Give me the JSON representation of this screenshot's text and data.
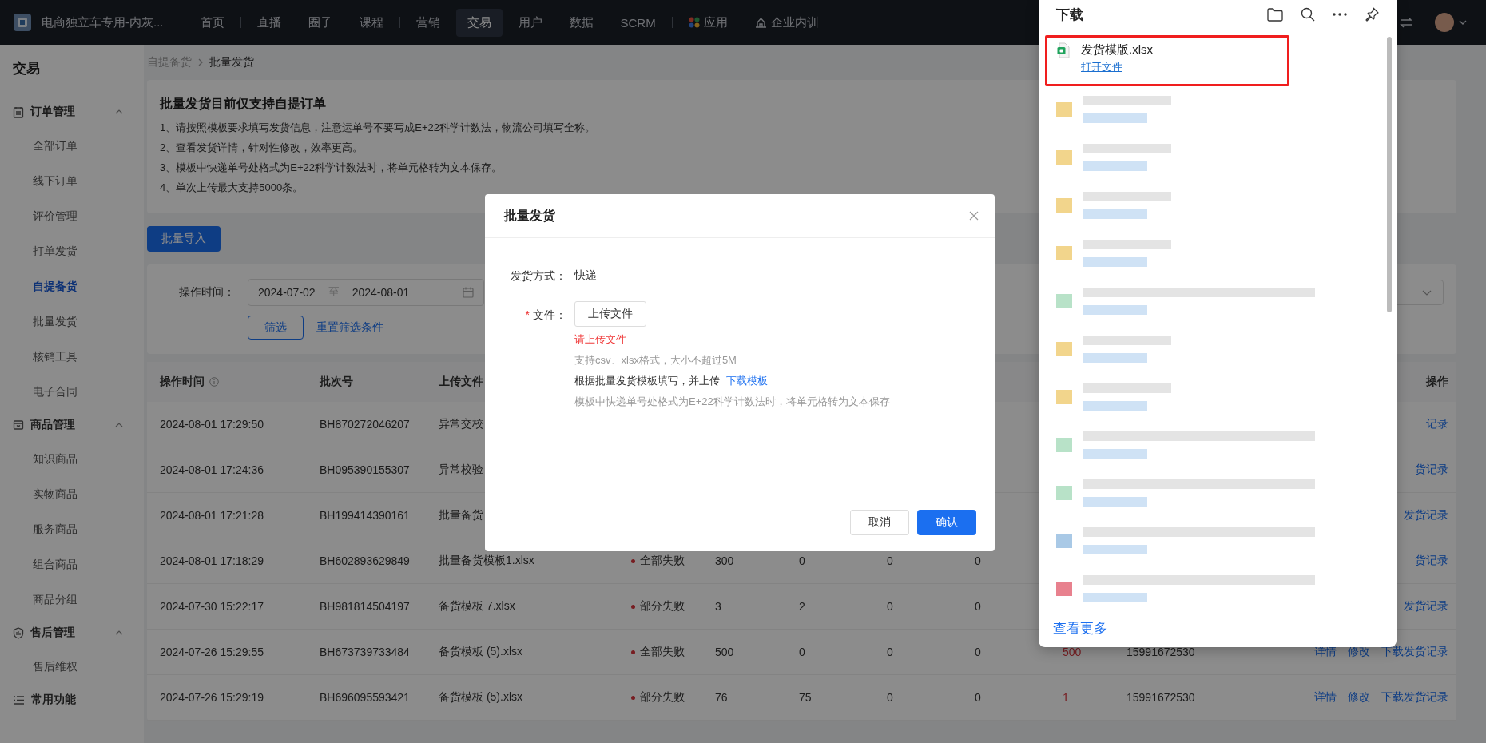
{
  "topbar": {
    "brand": "电商独立车专用-内灰...",
    "nav": [
      {
        "label": "首页",
        "selected": false,
        "divider_before": false,
        "kind": "text"
      },
      {
        "label": "直播",
        "selected": false,
        "divider_before": true,
        "kind": "text"
      },
      {
        "label": "圈子",
        "selected": false,
        "divider_before": false,
        "kind": "text"
      },
      {
        "label": "课程",
        "selected": false,
        "divider_before": false,
        "kind": "text"
      },
      {
        "label": "营销",
        "selected": false,
        "divider_before": true,
        "kind": "text"
      },
      {
        "label": "交易",
        "selected": true,
        "divider_before": false,
        "kind": "text"
      },
      {
        "label": "用户",
        "selected": false,
        "divider_before": false,
        "kind": "text"
      },
      {
        "label": "数据",
        "selected": false,
        "divider_before": false,
        "kind": "text"
      },
      {
        "label": "SCRM",
        "selected": false,
        "divider_before": false,
        "kind": "text"
      },
      {
        "label": "应用",
        "selected": false,
        "divider_before": true,
        "kind": "apps"
      },
      {
        "label": "企业内训",
        "selected": false,
        "divider_before": false,
        "kind": "training"
      }
    ]
  },
  "sidebar": {
    "title": "交易",
    "groups": [
      {
        "label": "订单管理",
        "kind": "orders",
        "expanded": true,
        "items": [
          {
            "label": "全部订单",
            "selected": false
          },
          {
            "label": "线下订单",
            "selected": false
          },
          {
            "label": "评价管理",
            "selected": false
          },
          {
            "label": "打单发货",
            "selected": false
          },
          {
            "label": "自提备货",
            "selected": true
          },
          {
            "label": "批量发货",
            "selected": false
          },
          {
            "label": "核销工具",
            "selected": false
          },
          {
            "label": "电子合同",
            "selected": false
          }
        ]
      },
      {
        "label": "商品管理",
        "kind": "goods",
        "expanded": true,
        "items": [
          {
            "label": "知识商品",
            "selected": false
          },
          {
            "label": "实物商品",
            "selected": false
          },
          {
            "label": "服务商品",
            "selected": false
          },
          {
            "label": "组合商品",
            "selected": false
          },
          {
            "label": "商品分组",
            "selected": false
          }
        ]
      },
      {
        "label": "售后管理",
        "kind": "aftersale",
        "expanded": true,
        "items": [
          {
            "label": "售后维权",
            "selected": false
          }
        ]
      },
      {
        "label": "常用功能",
        "kind": "common"
      }
    ]
  },
  "breadcrumb": [
    "自提备货",
    "批量发货"
  ],
  "notice": {
    "title": "批量发货目前仅支持自提订单",
    "lines": [
      "1、请按照模板要求填写发货信息，注意运单号不要写成E+22科学计数法，物流公司填写全称。",
      "2、查看发货详情，针对性修改，效率更高。",
      "3、模板中快递单号处格式为E+22科学计数法时，将单元格转为文本保存。",
      "4、单次上传最大支持5000条。"
    ]
  },
  "import_button": "批量导入",
  "filter": {
    "label": "操作时间：",
    "start": "2024-07-02",
    "separator": "至",
    "end": "2024-08-01",
    "filter_button": "筛选",
    "reset_link": "重置筛选条件"
  },
  "table": {
    "headers": {
      "time": "操作时间",
      "batch_no": "批次号",
      "file": "上传文件",
      "actions": "操作"
    },
    "rows": [
      {
        "time": "2024-08-01 17:29:50",
        "batch_no": "BH870272046207",
        "file": "异常交校",
        "actions": [
          "记录"
        ]
      },
      {
        "time": "2024-08-01 17:24:36",
        "batch_no": "BH095390155307",
        "file": "异常校验",
        "actions": [
          "货记录"
        ]
      },
      {
        "time": "2024-08-01 17:21:28",
        "batch_no": "BH199414390161",
        "file": "批量备货",
        "actions": [
          "发货记录"
        ]
      },
      {
        "time": "2024-08-01 17:18:29",
        "batch_no": "BH602893629849",
        "file": "批量备货模板1.xlsx",
        "status": "全部失败",
        "column_5": "300",
        "column_6": "0",
        "column_7": "0",
        "column_8": "0",
        "actions": [
          "货记录"
        ]
      },
      {
        "time": "2024-07-30 15:22:17",
        "batch_no": "BH981814504197",
        "file": "备货模板 7.xlsx",
        "status": "部分失败",
        "column_5": "3",
        "column_6": "2",
        "column_7": "0",
        "column_8": "0",
        "actions": [
          "发货记录"
        ]
      },
      {
        "time": "2024-07-26 15:29:55",
        "batch_no": "BH673739733484",
        "file": "备货模板 (5).xlsx",
        "status": "全部失败",
        "column_5": "500",
        "column_6": "0",
        "column_7": "0",
        "column_8": "0",
        "column_9": "500",
        "column_10": "15991672530",
        "actions": [
          "详情",
          "修改",
          "下载发货记录"
        ]
      },
      {
        "time": "2024-07-26 15:29:19",
        "batch_no": "BH696095593421",
        "file": "备货模板 (5).xlsx",
        "status": "部分失败",
        "column_5": "76",
        "column_6": "75",
        "column_7": "0",
        "column_8": "0",
        "column_9": "1",
        "column_10": "15991672530",
        "actions": [
          "详情",
          "修改",
          "下载发货记录"
        ]
      }
    ]
  },
  "modal": {
    "title": "批量发货",
    "method_label": "发货方式：",
    "method_value": "快递",
    "file_label": "文件：",
    "required_mark": "*",
    "upload_button": "上传文件",
    "error": "请上传文件",
    "hint": "支持csv、xlsx格式，大小不超过5M",
    "template_text": "根据批量发货模板填写，并上传",
    "template_link": "下载模板",
    "note": "模板中快递单号处格式为E+22科学计数法时，将单元格转为文本保存",
    "cancel": "取消",
    "confirm": "确认"
  },
  "downloads": {
    "title": "下载",
    "items": [
      {
        "name": "发货模版.xlsx",
        "action": "打开文件",
        "highlighted": true
      }
    ],
    "blurred_items": [
      {
        "color": "#f2d58c",
        "kind": "short"
      },
      {
        "color": "#f2d58c",
        "kind": "short"
      },
      {
        "color": "#f2d58c",
        "kind": "short"
      },
      {
        "color": "#f2d58c",
        "kind": "short"
      },
      {
        "color": "#b8e2c8",
        "kind": "long"
      },
      {
        "color": "#f2d58c",
        "kind": "short"
      },
      {
        "color": "#f2d58c",
        "kind": "short"
      },
      {
        "color": "#b8e2c8",
        "kind": "long"
      },
      {
        "color": "#b8e2c8",
        "kind": "long"
      },
      {
        "color": "#a9c9e6",
        "kind": "long"
      },
      {
        "color": "#e8818e",
        "kind": "long"
      }
    ],
    "more_link": "查看更多"
  }
}
